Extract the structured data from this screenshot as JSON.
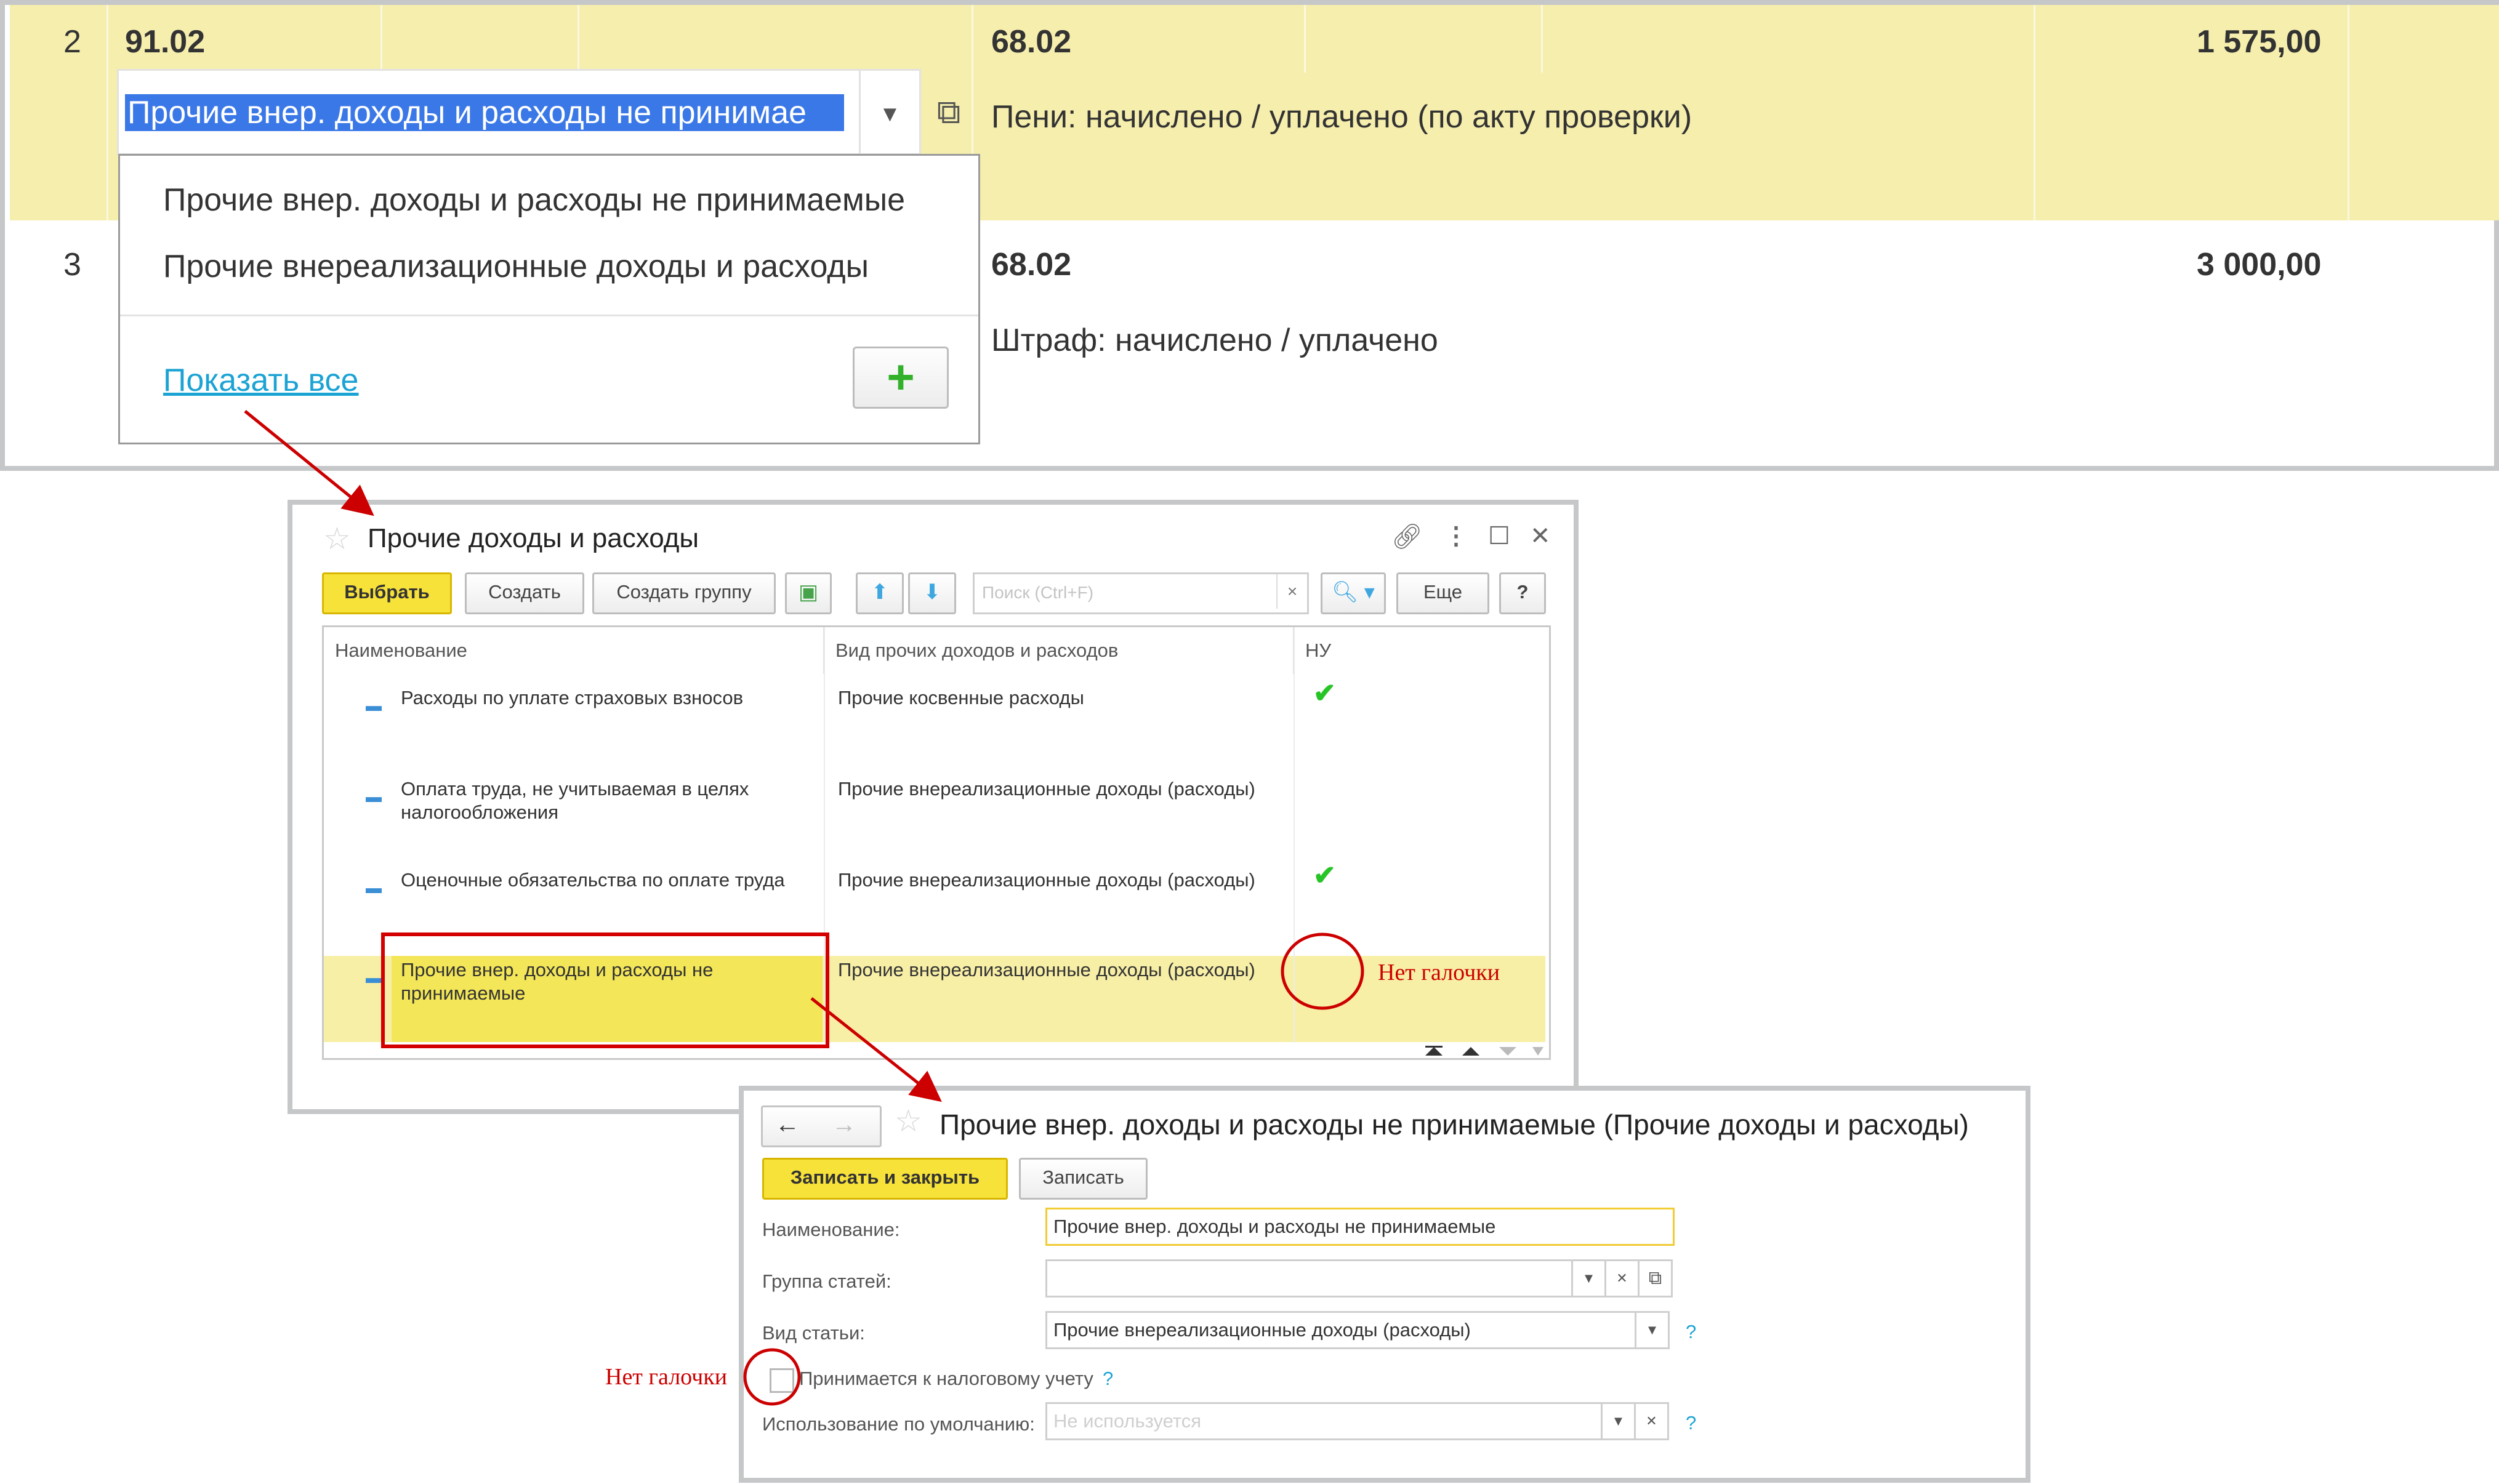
{
  "grid": {
    "rows": [
      {
        "num": "2",
        "account": "91.02",
        "account2": "68.02",
        "amount": "1 575,00",
        "content": "Пени: начислено / уплачено (по акту проверки)"
      },
      {
        "num": "3",
        "account2": "68.02",
        "amount": "3 000,00",
        "content": "Штраф: начислено / уплачено"
      }
    ],
    "selected_value": "Прочие внер. доходы и расходы не принимае",
    "dropdown": {
      "items": [
        "Прочие внер. доходы и расходы не принимаемые",
        "Прочие внереализационные доходы и расходы"
      ],
      "show_all": "Показать все",
      "add_label": "+"
    }
  },
  "list_window": {
    "title": "Прочие доходы и расходы",
    "toolbar": {
      "select": "Выбрать",
      "create": "Создать",
      "create_group": "Создать группу",
      "search_placeholder": "Поиск (Ctrl+F)",
      "search_clear": "×",
      "more": "Еще",
      "help": "?"
    },
    "columns": [
      "Наименование",
      "Вид прочих доходов и расходов",
      "НУ"
    ],
    "rows": [
      {
        "name": "Расходы по уплате страховых взносов",
        "name2": "",
        "kind": "Прочие косвенные расходы",
        "tax": "✔"
      },
      {
        "name": "Оплата труда, не учитываемая в целях",
        "name2": "налогообложения",
        "kind": "Прочие внереализационные доходы (расходы)",
        "tax": ""
      },
      {
        "name": "Оценочные обязательства по оплате труда",
        "name2": "",
        "kind": "Прочие внереализационные доходы (расходы)",
        "tax": "✔"
      },
      {
        "name": "Прочие внер. доходы и расходы не",
        "name2": "принимаемые",
        "kind": "Прочие внереализационные доходы (расходы)",
        "tax": ""
      }
    ]
  },
  "item_window": {
    "title": "Прочие внер. доходы и расходы не принимаемые (Прочие доходы и расходы)",
    "save_close": "Записать и закрыть",
    "save": "Записать",
    "fields": {
      "name_label": "Наименование:",
      "name_value": "Прочие внер. доходы и расходы не принимаемые",
      "group_label": "Группа статей:",
      "group_value": "",
      "kind_label": "Вид статьи:",
      "kind_value": "Прочие внереализационные доходы (расходы)",
      "tax_label": "Принимается к налоговому учету",
      "default_label": "Использование по умолчанию:",
      "default_placeholder": "Не используется"
    }
  },
  "annotations": {
    "no_check_1": "Нет галочки",
    "no_check_2": "Нет галочки"
  },
  "colors": {
    "row_yellow": "#f6eead",
    "accent_yellow": "#f7e23a",
    "annotation_red": "#cc0000",
    "check_green": "#27c427",
    "link_blue": "#1ba3d4"
  }
}
